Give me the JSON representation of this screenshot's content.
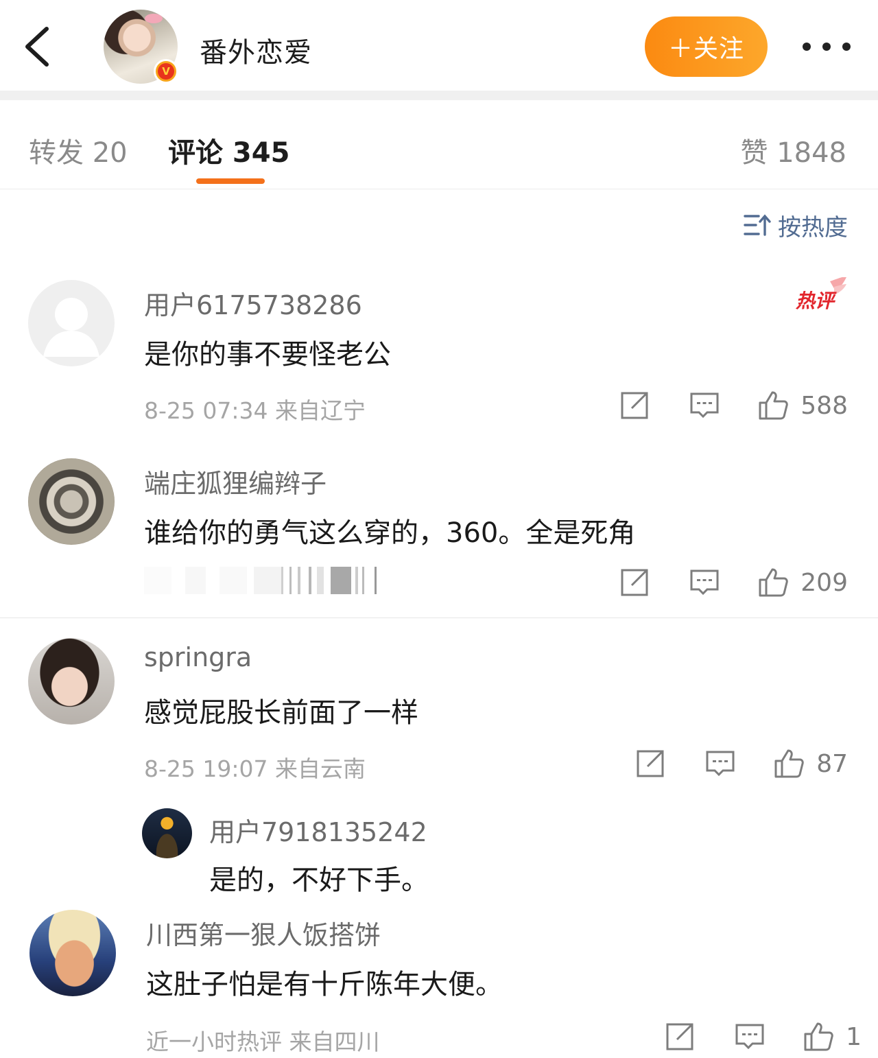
{
  "header": {
    "back_icon": "chevron-left-icon",
    "name": "番外恋爱",
    "verified_mark": "V",
    "follow_label": "＋关注",
    "more_icon": "more-dots-icon"
  },
  "tabs": {
    "repost": "转发 20",
    "comment": "评论 345",
    "like": "赞 1848"
  },
  "sort": {
    "label": "按热度",
    "icon": "sort-icon"
  },
  "hot_badge": "热评",
  "colors": {
    "accent": "#f4711b",
    "follow_start": "#fb8a11",
    "follow_end": "#fda72b",
    "sort_blue": "#526c92",
    "hot_red": "#e2262d"
  },
  "comments": [
    {
      "user": "用户6175738286",
      "text": "是你的事不要怪老公",
      "meta": "8-25 07:34 来自辽宁",
      "likes": "588"
    },
    {
      "user": "端庄狐狸编辫子",
      "text": "谁给你的勇气这么穿的，360。全是死角",
      "meta": "",
      "likes": "209"
    },
    {
      "user": "springra",
      "text": "感觉屁股长前面了一样",
      "meta": "8-25 19:07 来自云南",
      "likes": "87"
    },
    {
      "user": "川西第一狠人饭搭饼",
      "text": "这肚子怕是有十斤陈年大便。",
      "meta": "近一小时热评 来自四川",
      "likes": "1"
    }
  ],
  "reply": {
    "user": "用户7918135242",
    "text": "是的，不好下手。"
  }
}
